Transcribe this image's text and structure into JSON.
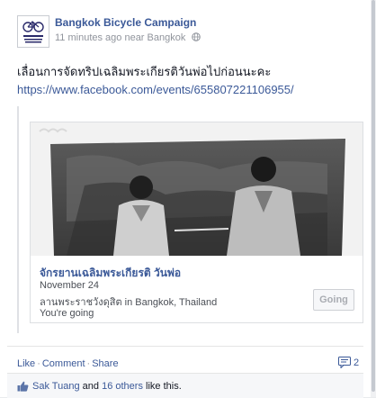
{
  "post": {
    "page_name": "Bangkok Bicycle Campaign",
    "timestamp": "11 minutes ago near Bangkok",
    "avatar_text": "Bangkok Bicycle Campaign",
    "status_text": "เลื่อนการจัดทริปเฉลิมพระเกียรติวันพ่อไปก่อนนะคะ",
    "link_url": "https://www.facebook.com/events/655807221106955/"
  },
  "event_card": {
    "title": "จักรยานเฉลิมพระเกียรติ วันพ่อ",
    "date": "November 24",
    "location": "ลานพระราชวังดุสิต in Bangkok, Thailand",
    "rsvp_status": "You're going",
    "going_button": "Going"
  },
  "actions": {
    "like": "Like",
    "comment": "Comment",
    "share": "Share",
    "separator": "·",
    "comment_count": "2"
  },
  "likes": {
    "first_name": "Sak Tuang",
    "and_text": "and",
    "others_text": "16 others",
    "suffix": "like this."
  }
}
